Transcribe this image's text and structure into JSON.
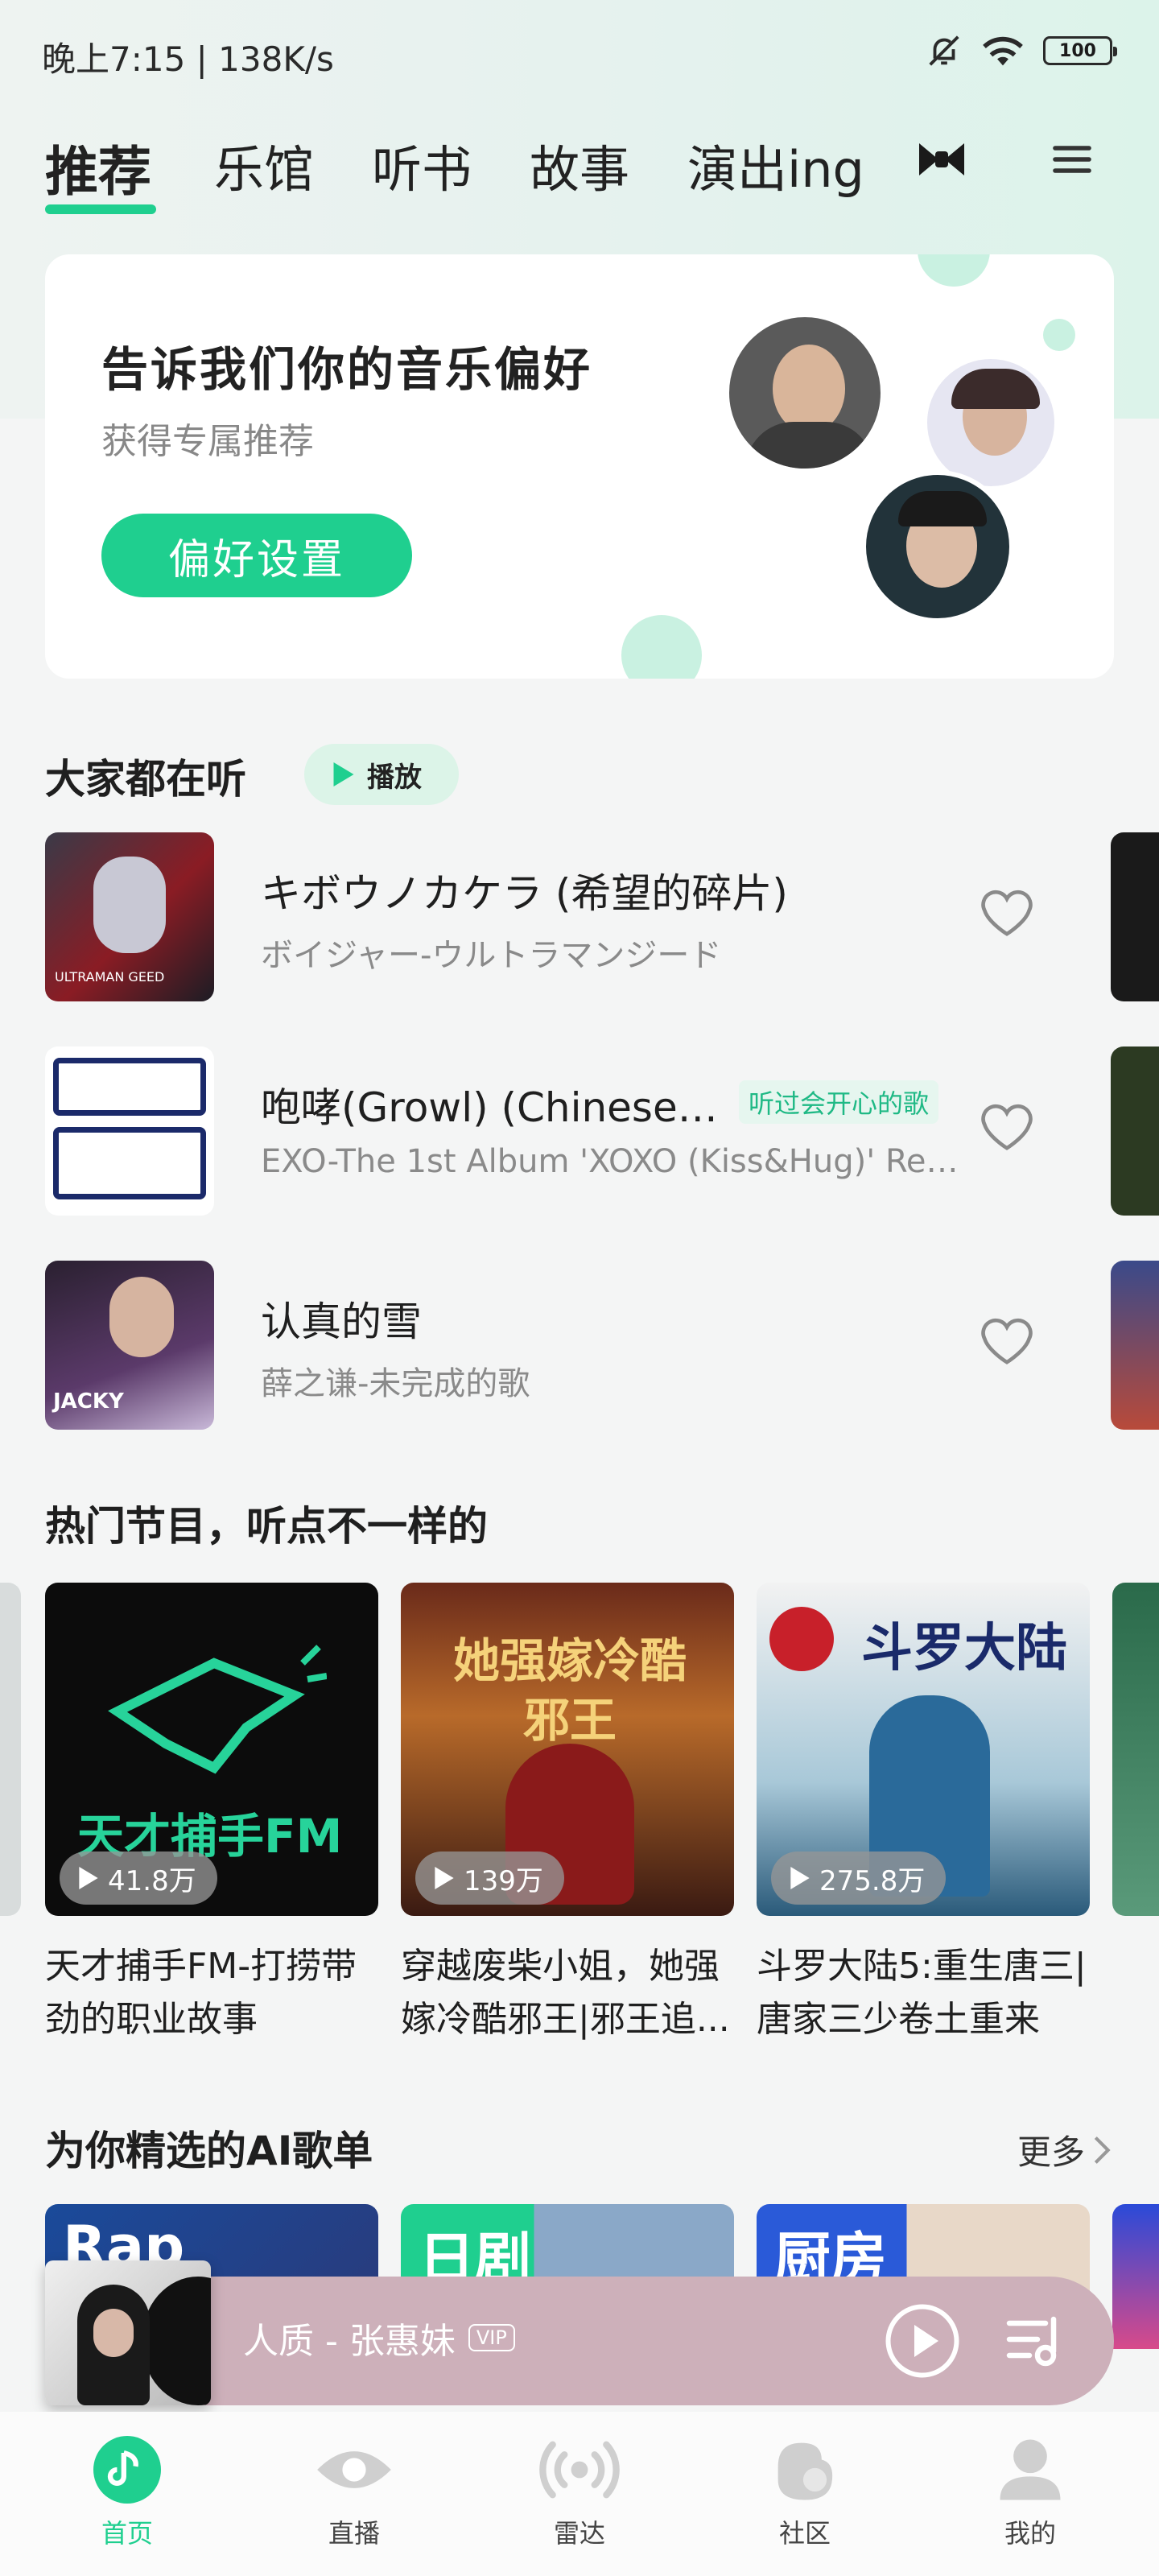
{
  "status_bar": {
    "time": "晚上7:15 | 138K/s",
    "battery": "100"
  },
  "tabs": [
    {
      "label": "推荐",
      "active": true
    },
    {
      "label": "乐馆"
    },
    {
      "label": "听书"
    },
    {
      "label": "故事"
    },
    {
      "label": "演出ing"
    }
  ],
  "preference_card": {
    "title": "告诉我们你的音乐偏好",
    "subtitle": "获得专属推荐",
    "button": "偏好设置"
  },
  "popular": {
    "title": "大家都在听",
    "play_label": "播放",
    "songs": [
      {
        "title": "キボウノカケラ (希望的碎片)",
        "subtitle": "ボイジャー-ウルトラマンジード",
        "tag": ""
      },
      {
        "title": "咆哮(Growl) (Chinese ...",
        "subtitle": "EXO-The 1st Album 'XOXO (Kiss&Hug)' Rep...",
        "tag": "听过会开心的歌"
      },
      {
        "title": "认真的雪",
        "subtitle": "薛之谦-未完成的歌",
        "tag": ""
      }
    ]
  },
  "programs": {
    "title": "热门节目，听点不一样的",
    "items": [
      {
        "count": "41.8万",
        "title": "天才捕手FM-打捞带劲的职业故事",
        "cover_text": "天才捕手FM"
      },
      {
        "count": "139万",
        "title": "穿越废柴小姐，她强嫁冷酷邪王|邪王追...",
        "cover_text": "她强嫁冷酷邪王"
      },
      {
        "count": "275.8万",
        "title": "斗罗大陆5:重生唐三|唐家三少卷土重来",
        "cover_text": "斗罗大陆"
      }
    ]
  },
  "ai_playlists": {
    "title": "为你精选的AI歌单",
    "more": "更多",
    "items": [
      {
        "label": "Rap"
      },
      {
        "label": "日剧"
      },
      {
        "label": "厨房"
      }
    ]
  },
  "mini_player": {
    "text": "人质 - 张惠妹",
    "badge": "VIP"
  },
  "bottom_nav": [
    {
      "label": "首页",
      "active": true
    },
    {
      "label": "直播"
    },
    {
      "label": "雷达"
    },
    {
      "label": "社区"
    },
    {
      "label": "我的"
    }
  ],
  "colors": {
    "accent": "#1fcf8f",
    "player_bg": "#cdb0ba"
  }
}
